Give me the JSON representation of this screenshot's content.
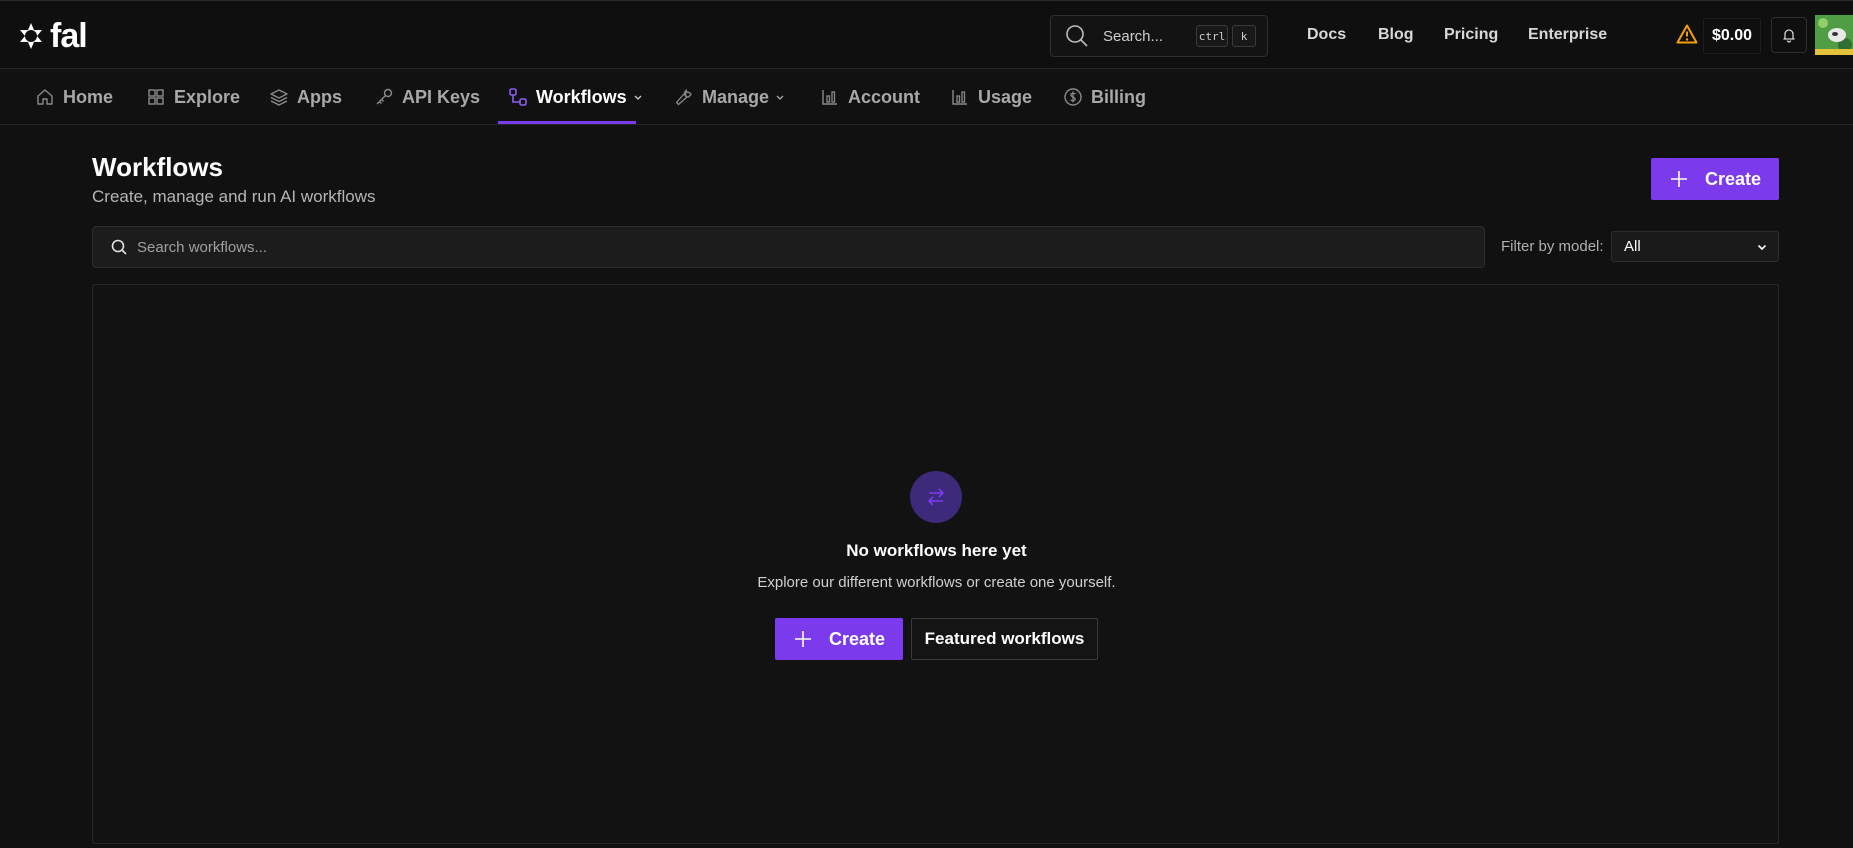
{
  "app": {
    "logo_text": "fal"
  },
  "topbar": {
    "search_label": "Search...",
    "shortcut_ctrl": "ctrl",
    "shortcut_k": "k",
    "links": [
      "Docs",
      "Blog",
      "Pricing",
      "Enterprise"
    ],
    "balance": "$0.00",
    "warning_icon": "warning-triangle-icon",
    "bell_icon": "bell-icon"
  },
  "nav": {
    "items": [
      {
        "label": "Home",
        "icon": "home-icon"
      },
      {
        "label": "Explore",
        "icon": "grid-icon"
      },
      {
        "label": "Apps",
        "icon": "layers-icon"
      },
      {
        "label": "API Keys",
        "icon": "key-icon"
      },
      {
        "label": "Workflows",
        "icon": "workflow-icon",
        "active": true,
        "dropdown": true
      },
      {
        "label": "Manage",
        "icon": "wrench-icon",
        "dropdown": true
      },
      {
        "label": "Account",
        "icon": "bar-chart-icon"
      },
      {
        "label": "Usage",
        "icon": "bar-chart-icon"
      },
      {
        "label": "Billing",
        "icon": "dollar-circle-icon"
      }
    ]
  },
  "page": {
    "title": "Workflows",
    "subtitle": "Create, manage and run AI workflows",
    "create_label": "Create",
    "search_placeholder": "Search workflows...",
    "filter_label": "Filter by model:",
    "filter_value": "All"
  },
  "empty_state": {
    "icon": "swap-arrows-icon",
    "title": "No workflows here yet",
    "text": "Explore our different workflows or create one yourself.",
    "create_label": "Create",
    "featured_label": "Featured workflows"
  },
  "colors": {
    "accent": "#7c3aed",
    "background": "#111111",
    "warning": "#f59e0b"
  }
}
